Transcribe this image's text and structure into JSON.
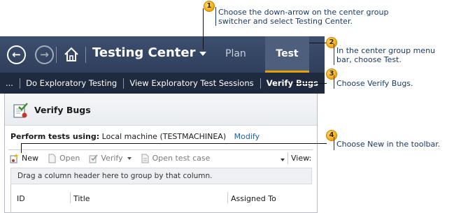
{
  "titlebar": {
    "back_glyph": "←",
    "forward_glyph": "→",
    "app_title": "Testing Center",
    "groups": [
      {
        "label": "Plan",
        "selected": false
      },
      {
        "label": "Test",
        "selected": true
      }
    ],
    "accent_color": "#e8a000"
  },
  "subnav": {
    "overflow": "...",
    "items": [
      {
        "label": "Do Exploratory Testing",
        "active": false
      },
      {
        "label": "View Exploratory Test Sessions",
        "active": false
      },
      {
        "label": "Verify Bugs",
        "active": true
      }
    ]
  },
  "panel": {
    "title": "Verify Bugs",
    "perform_label": "Perform tests using:",
    "perform_value": "Local machine (TESTMACHINEA)",
    "modify_link": "Modify",
    "toolbar": {
      "new": "New",
      "open": "Open",
      "verify": "Verify",
      "open_test_case": "Open test case",
      "view": "View:"
    },
    "group_hint": "Drag a column header here to group by that column.",
    "columns": [
      "ID",
      "Title",
      "Assigned To"
    ]
  },
  "callouts": [
    {
      "number": "1",
      "text": [
        "Choose the down-arrow on the center group",
        "switcher and select Testing Center."
      ]
    },
    {
      "number": "2",
      "text": [
        "In the center group menu",
        "bar, choose Test."
      ]
    },
    {
      "number": "3",
      "text": [
        "Choose Verify Bugs."
      ]
    },
    {
      "number": "4",
      "text": [
        "Choose New in the toolbar."
      ]
    }
  ],
  "icons": {
    "back": "back-arrow-icon",
    "forward": "forward-arrow-icon",
    "home": "home-icon",
    "switcher": "chevron-down-icon",
    "verify_bugs": "verify-bugs-icon",
    "new": "new-item-icon",
    "open": "open-document-icon",
    "verify": "verify-icon",
    "open_test_case": "test-case-icon",
    "callout_badge": "numbered-callout-icon"
  }
}
